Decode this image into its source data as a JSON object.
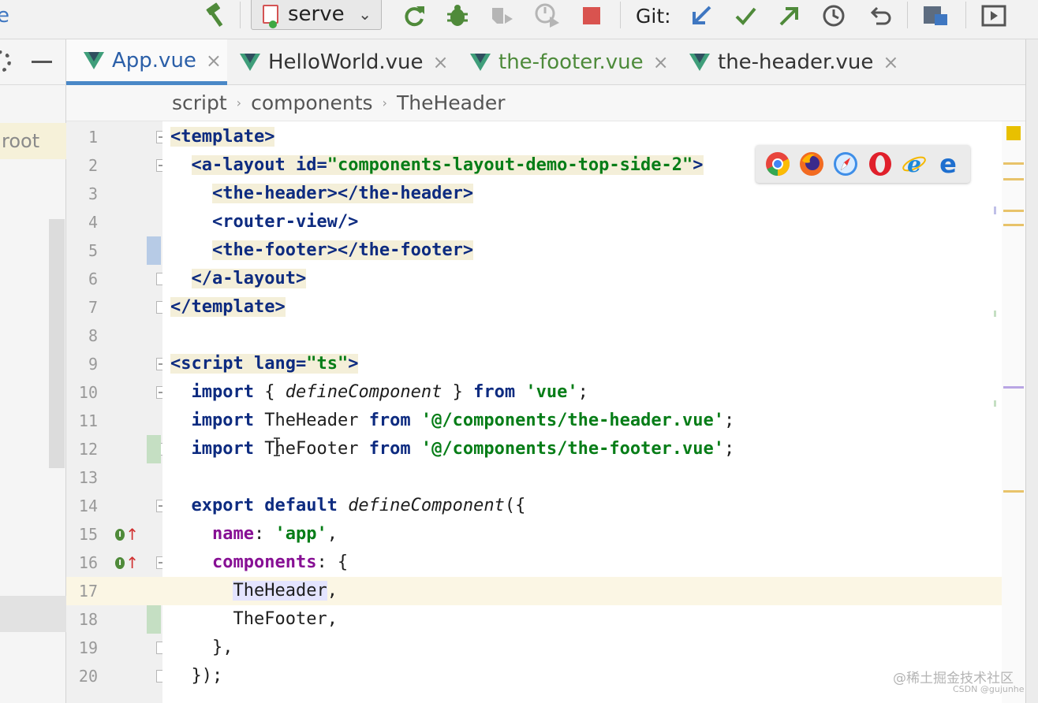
{
  "toolbar": {
    "run_config": "serve",
    "git_label": "Git:",
    "icons": [
      "build-hammer-icon",
      "rerun-icon",
      "debug-bug-icon",
      "coverage-icon",
      "profile-icon",
      "stop-icon",
      "git-update-icon",
      "git-commit-icon",
      "git-push-icon",
      "git-history-icon",
      "git-rollback-icon",
      "project-structure-icon",
      "run-anything-icon"
    ]
  },
  "project_panel": {
    "root_label": "root"
  },
  "tabs": [
    {
      "label": "App.vue",
      "active": true
    },
    {
      "label": "HelloWorld.vue"
    },
    {
      "label": "the-footer.vue",
      "modified": true
    },
    {
      "label": "the-header.vue"
    }
  ],
  "breadcrumb": [
    "script",
    "components",
    "TheHeader"
  ],
  "line_numbers": [
    "1",
    "2",
    "3",
    "4",
    "5",
    "6",
    "7",
    "8",
    "9",
    "10",
    "11",
    "12",
    "13",
    "14",
    "15",
    "16",
    "17",
    "18",
    "19",
    "20"
  ],
  "code": {
    "l1_tag": "<template>",
    "l2_open": "<a-layout ",
    "l2_attr": "id=",
    "l2_val": "\"components-layout-demo-top-side-2\"",
    "l2_close": ">",
    "l3": "<the-header></the-header>",
    "l4": "<router-view/>",
    "l5": "<the-footer></the-footer>",
    "l6": "</a-layout>",
    "l7": "</template>",
    "l9_open": "<script ",
    "l9_attr": "lang=",
    "l9_val": "\"ts\"",
    "l9_close": ">",
    "l10_kw": "import",
    "l10_a": " { ",
    "l10_fn": "defineComponent",
    "l10_b": " } ",
    "l10_from": "from",
    "l10_str": "'vue'",
    "l10_end": ";",
    "l11_kw": "import",
    "l11_id": " TheHeader ",
    "l11_from": "from",
    "l11_str": "'@/components/the-header.vue'",
    "l11_end": ";",
    "l12_kw": "import",
    "l12_id": " TheFooter ",
    "l12_from": "from",
    "l12_str": "'@/components/the-footer.vue'",
    "l12_end": ";",
    "l14_kw": "export default",
    "l14_fn": "defineComponent",
    "l14_end": "({",
    "l15_prop": "name",
    "l15_colon": ": ",
    "l15_str": "'app'",
    "l15_end": ",",
    "l16_prop": "components",
    "l16_end": ": {",
    "l17_id": "TheHeader",
    "l17_end": ",",
    "l18": "TheFooter,",
    "l19": "},",
    "l20": "});"
  },
  "browser_popup": [
    "chrome-icon",
    "firefox-icon",
    "safari-icon",
    "opera-icon",
    "internet-explorer-icon",
    "edge-icon"
  ],
  "watermark": "@稀土掘金技术社区",
  "watermark_small": "CSDN @gujunhe"
}
